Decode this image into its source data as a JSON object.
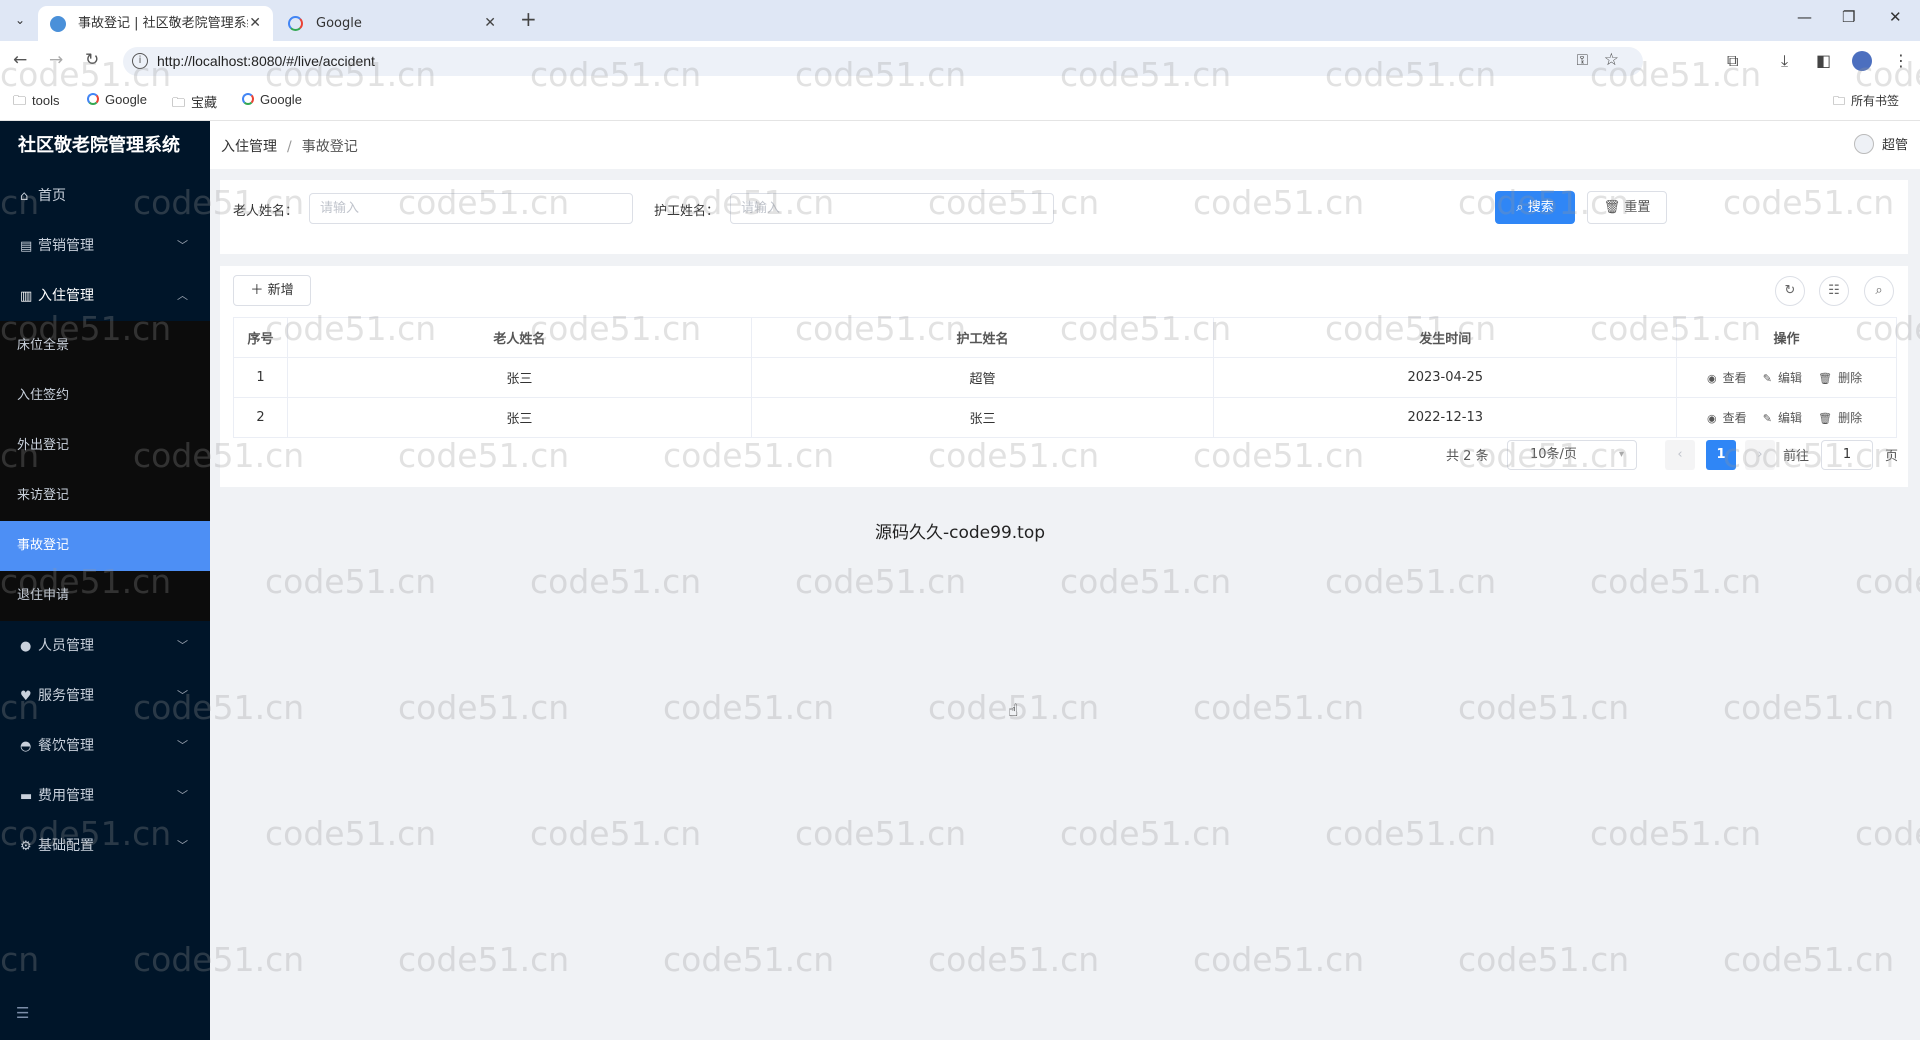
{
  "browser": {
    "tabs": [
      {
        "title": "事故登记 | 社区敬老院管理系统",
        "active": true
      },
      {
        "title": "Google",
        "active": false
      }
    ],
    "url": "http://localhost:8080/#/live/accident",
    "bookmarks": [
      "tools",
      "Google",
      "宝藏",
      "Google"
    ],
    "all_bookmarks": "所有书签"
  },
  "app": {
    "brand": "社区敬老院管理系统",
    "menu": {
      "home": "首页",
      "sales": "营销管理",
      "checkin": "入住管理",
      "checkin_sub": [
        "床位全景",
        "入住签约",
        "外出登记",
        "来访登记",
        "事故登记",
        "退住申请"
      ],
      "staff": "人员管理",
      "service": "服务管理",
      "dining": "餐饮管理",
      "fees": "费用管理",
      "config": "基础配置"
    },
    "breadcrumb": {
      "parent": "入住管理",
      "current": "事故登记"
    },
    "user": "超管"
  },
  "search": {
    "elder_label": "老人姓名：",
    "elder_placeholder": "请输入",
    "nurse_label": "护工姓名：",
    "nurse_placeholder": "请输入",
    "search_btn": "搜索",
    "reset_btn": "重置"
  },
  "table": {
    "add_btn": "新增",
    "columns": [
      "序号",
      "老人姓名",
      "护工姓名",
      "发生时间",
      "操作"
    ],
    "rows": [
      {
        "no": "1",
        "elder": "张三",
        "nurse": "超管",
        "date": "2023-04-25"
      },
      {
        "no": "2",
        "elder": "张三",
        "nurse": "张三",
        "date": "2022-12-13"
      }
    ],
    "ops": {
      "view": "查看",
      "edit": "编辑",
      "delete": "删除"
    }
  },
  "pagination": {
    "total": "共 2 条",
    "page_size": "10条/页",
    "current": "1",
    "goto": "前往",
    "goto_value": "1",
    "page_unit": "页"
  },
  "footer": "源码久久-code99.top",
  "watermark": "code51.cn",
  "colors": {
    "sidebar": "#001529",
    "active": "#4d8ff5",
    "primary": "#2f86f6"
  }
}
